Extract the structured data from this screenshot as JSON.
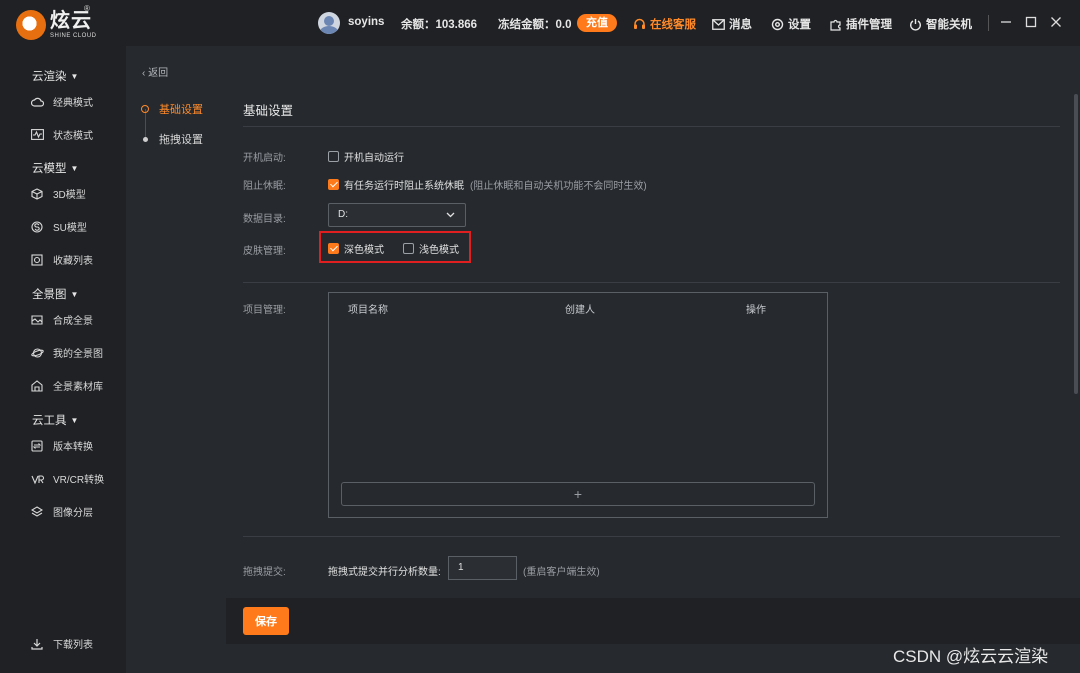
{
  "header": {
    "logo_text": "炫云",
    "logo_sub": "SHINE CLOUD",
    "logo_reg": "®",
    "username": "soyins",
    "balance": "余额：103.866",
    "frozen": "冻结金额：0.0",
    "recharge_label": "充值",
    "support_label": "在线客服",
    "messages_label": "消息",
    "settings_label": "设置",
    "plugins_label": "插件管理",
    "shutdown_label": "智能关机",
    "accent_color": "#ff7a1a"
  },
  "sidebar": {
    "groups": [
      {
        "label": "云渲染",
        "items": [
          {
            "label": "经典模式",
            "icon": "cloud-icon"
          },
          {
            "label": "状态模式",
            "icon": "pulse-icon"
          }
        ]
      },
      {
        "label": "云模型",
        "items": [
          {
            "label": "3D模型",
            "icon": "cube-icon"
          },
          {
            "label": "SU模型",
            "icon": "su-icon"
          },
          {
            "label": "收藏列表",
            "icon": "bookmark-icon"
          }
        ]
      },
      {
        "label": "全景图",
        "items": [
          {
            "label": "合成全景",
            "icon": "panorama-icon"
          },
          {
            "label": "我的全景图",
            "icon": "planet-icon"
          },
          {
            "label": "全景素材库",
            "icon": "library-icon"
          }
        ]
      },
      {
        "label": "云工具",
        "items": [
          {
            "label": "版本转换",
            "icon": "convert-icon"
          },
          {
            "label": "VR/CR转换",
            "icon": "vr-icon"
          },
          {
            "label": "图像分层",
            "icon": "layers-icon"
          }
        ]
      }
    ],
    "download_label": "下载列表"
  },
  "subnav": {
    "back_label": "返回",
    "items": [
      {
        "label": "基础设置",
        "active": true
      },
      {
        "label": "拖拽设置",
        "active": false
      }
    ]
  },
  "settings": {
    "title": "基础设置",
    "autostart_label": "开机启动:",
    "autostart_option": "开机自动运行",
    "autostart_checked": false,
    "sleep_label": "阻止休眠:",
    "sleep_option": "有任务运行时阻止系统休眠",
    "sleep_hint": "(阻止休眠和自动关机功能不会同时生效)",
    "sleep_checked": true,
    "dir_label": "数据目录:",
    "dir_value": "D:",
    "skin_label": "皮肤管理:",
    "skin_dark": "深色模式",
    "skin_dark_checked": true,
    "skin_light": "浅色模式",
    "skin_light_checked": false,
    "project_label": "项目管理:",
    "project_columns": [
      "项目名称",
      "创建人",
      "操作"
    ],
    "add_symbol": "+",
    "drag_label": "拖拽提交:",
    "drag_sub_label": "拖拽式提交并行分析数量:",
    "drag_value": "1",
    "drag_hint": "(重启客户端生效)",
    "save_label": "保存"
  },
  "watermark": "CSDN @炫云云渲染"
}
